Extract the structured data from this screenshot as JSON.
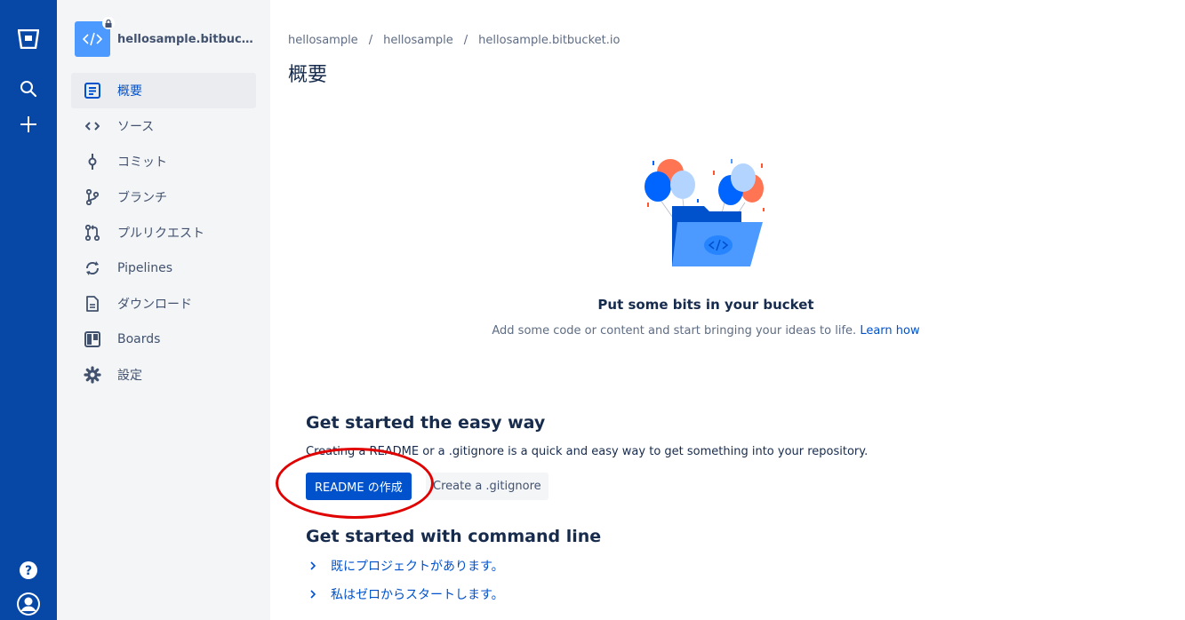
{
  "global_nav": {
    "items": [
      "bitbucket-logo",
      "search",
      "create",
      "help",
      "profile"
    ]
  },
  "sidebar": {
    "repo_name": "hellosample.bitbucket....",
    "items": [
      {
        "label": "概要",
        "icon": "overview-icon",
        "active": true
      },
      {
        "label": "ソース",
        "icon": "source-code-icon"
      },
      {
        "label": "コミット",
        "icon": "commit-icon"
      },
      {
        "label": "ブランチ",
        "icon": "branch-icon"
      },
      {
        "label": "プルリクエスト",
        "icon": "pull-request-icon"
      },
      {
        "label": "Pipelines",
        "icon": "pipelines-icon"
      },
      {
        "label": "ダウンロード",
        "icon": "download-icon"
      },
      {
        "label": "Boards",
        "icon": "boards-icon"
      },
      {
        "label": "設定",
        "icon": "settings-icon"
      }
    ]
  },
  "breadcrumb": [
    "hellosample",
    "hellosample",
    "hellosample.bitbucket.io"
  ],
  "page_title": "概要",
  "empty_state": {
    "title": "Put some bits in your bucket",
    "description": "Add some code or content and start bringing your ideas to life.",
    "link": "Learn how"
  },
  "easy_way": {
    "heading": "Get started the easy way",
    "description": "Creating a README or a .gitignore is a quick and easy way to get something into your repository.",
    "readme_button": "README の作成",
    "gitignore_button": "Create a .gitignore"
  },
  "command_line": {
    "heading": "Get started with command line",
    "items": [
      "既にプロジェクトがあります。",
      "私はゼロからスタートします。"
    ]
  },
  "colors": {
    "nav_bg": "#0747a6",
    "sidebar_bg": "#f4f5f7",
    "primary": "#0052cc",
    "annotation_ring": "#e00000"
  }
}
